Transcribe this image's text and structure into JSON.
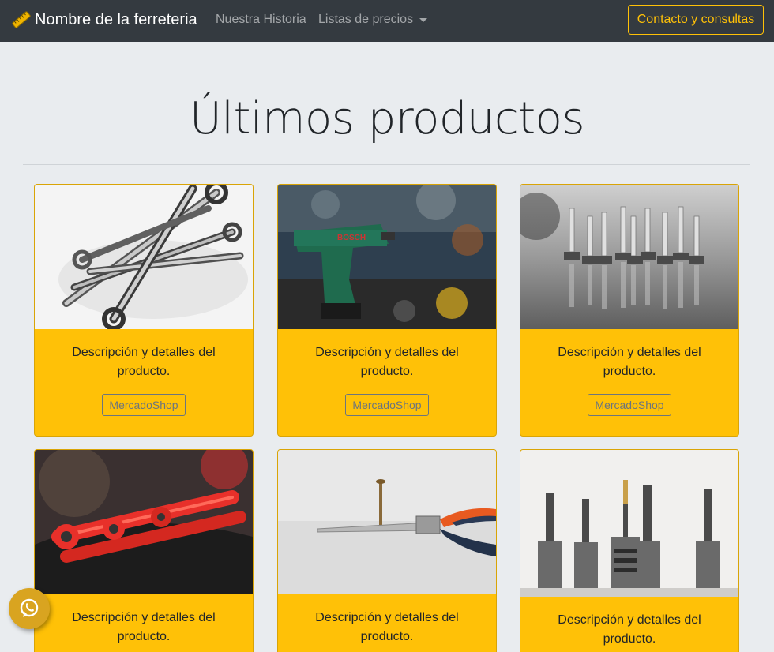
{
  "navbar": {
    "brand": "Nombre de la ferreteria",
    "brand_icon": "ruler-level-icon",
    "links": [
      "Nuestra Historia",
      "Listas de precios"
    ],
    "contact_button": "Contacto y consultas",
    "accent": "#ffc107"
  },
  "hero": {
    "title": "Últimos productos"
  },
  "products": [
    {
      "image": "wrenches-photo",
      "description": "Descripción y detalles del producto.",
      "button": "MercadoShop"
    },
    {
      "image": "cordless-drill-photo",
      "description": "Descripción y detalles del producto.",
      "button": "MercadoShop"
    },
    {
      "image": "screws-photo",
      "description": "Descripción y detalles del producto.",
      "button": "MercadoShop"
    },
    {
      "image": "ratchet-wrench-photo",
      "description": "Descripción y detalles del producto."
    },
    {
      "image": "pliers-screw-photo",
      "description": "Descripción y detalles del producto."
    },
    {
      "image": "drill-bits-photo",
      "description": "Descripción y detalles del producto."
    }
  ],
  "floating": {
    "whatsapp_icon": "whatsapp-icon"
  }
}
